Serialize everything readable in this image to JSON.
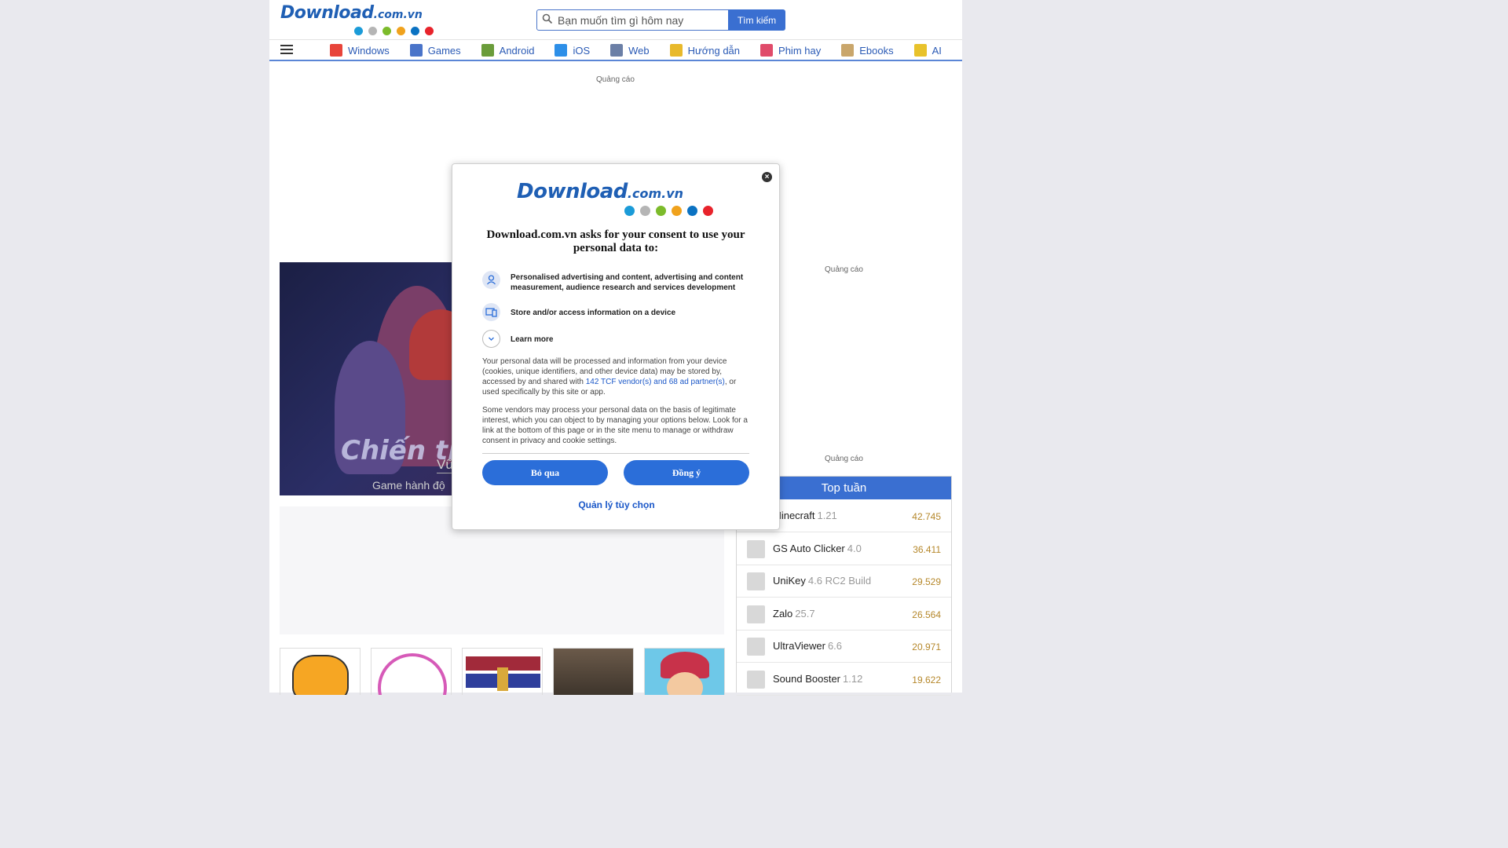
{
  "header": {
    "logo_word": "Download",
    "logo_domain": ".com.vn",
    "dot_colors": [
      "#1b9bd8",
      "#b5b5b5",
      "#7cbb2b",
      "#f0a21d",
      "#0b72c2",
      "#e8232b"
    ],
    "search_placeholder": "Bạn muốn tìm gì hôm nay",
    "search_button": "Tìm kiếm"
  },
  "nav": {
    "items": [
      {
        "label": "Windows",
        "icon": "windows-icon",
        "color": "#e8443a"
      },
      {
        "label": "Games",
        "icon": "gamepad-icon",
        "color": "#4a74c9"
      },
      {
        "label": "Android",
        "icon": "android-icon",
        "color": "#6a9c3a"
      },
      {
        "label": "iOS",
        "icon": "app-store-icon",
        "color": "#2d8fe8"
      },
      {
        "label": "Web",
        "icon": "globe-icon",
        "color": "#6b7fa6"
      },
      {
        "label": "Hướng dẫn",
        "icon": "lightbulb-icon",
        "color": "#e8b92b"
      },
      {
        "label": "Phim hay",
        "icon": "film-icon",
        "color": "#e04b6a"
      },
      {
        "label": "Ebooks",
        "icon": "book-icon",
        "color": "#c9a66b"
      },
      {
        "label": "AI",
        "icon": "sparkle-icon",
        "color": "#e8c22b"
      }
    ]
  },
  "ads": {
    "label_top": "Quảng cáo",
    "label_right1": "Quảng cáo",
    "label_right2": "Quảng cáo"
  },
  "hero": {
    "title": "Chiến tr",
    "name": "Vũ",
    "subtitle": "Game hành độ"
  },
  "top_week": {
    "title": "Top tuần",
    "items": [
      {
        "name": "Minecraft",
        "version": "1.21",
        "count": "42.745"
      },
      {
        "name": "GS Auto Clicker",
        "version": "4.0",
        "count": "36.411"
      },
      {
        "name": "UniKey",
        "version": "4.6 RC2 Build",
        "count": "29.529"
      },
      {
        "name": "Zalo",
        "version": "25.7",
        "count": "26.564"
      },
      {
        "name": "UltraViewer",
        "version": "6.6",
        "count": "20.971"
      },
      {
        "name": "Sound Booster",
        "version": "1.12",
        "count": "19.622"
      }
    ]
  },
  "consent": {
    "title": "Download.com.vn asks for your consent to use your personal data to:",
    "purpose1": "Personalised advertising and content, advertising and content measurement, audience research and services development",
    "purpose2": "Store and/or access information on a device",
    "learn_more": "Learn more",
    "para1_before": "Your personal data will be processed and information from your device (cookies, unique identifiers, and other device data) may be stored by, accessed by and shared with ",
    "para1_link": "142 TCF vendor(s) and 68 ad partner(s)",
    "para1_after": ", or used specifically by this site or app.",
    "para2": "Some vendors may process your personal data on the basis of legitimate interest, which you can object to by managing your options below. Look for a link at the bottom of this page or in the site menu to manage or withdraw consent in privacy and cookie settings.",
    "skip_button": "Bỏ qua",
    "agree_button": "Đồng ý",
    "manage_link": "Quản lý tùy chọn"
  }
}
